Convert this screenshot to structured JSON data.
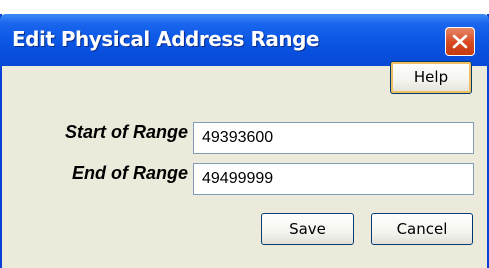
{
  "dialog": {
    "title": "Edit Physical Address Range",
    "help_label": "Help",
    "save_label": "Save",
    "cancel_label": "Cancel"
  },
  "form": {
    "start_label": "Start of Range",
    "start_value": "49393600",
    "end_label": "End of Range",
    "end_value": "49499999"
  },
  "icons": {
    "close": "close-icon"
  },
  "colors": {
    "titlebar": "#0a55e3",
    "close_button": "#d8491f",
    "dialog_background": "#eceadb",
    "field_border": "#7f9db9"
  }
}
